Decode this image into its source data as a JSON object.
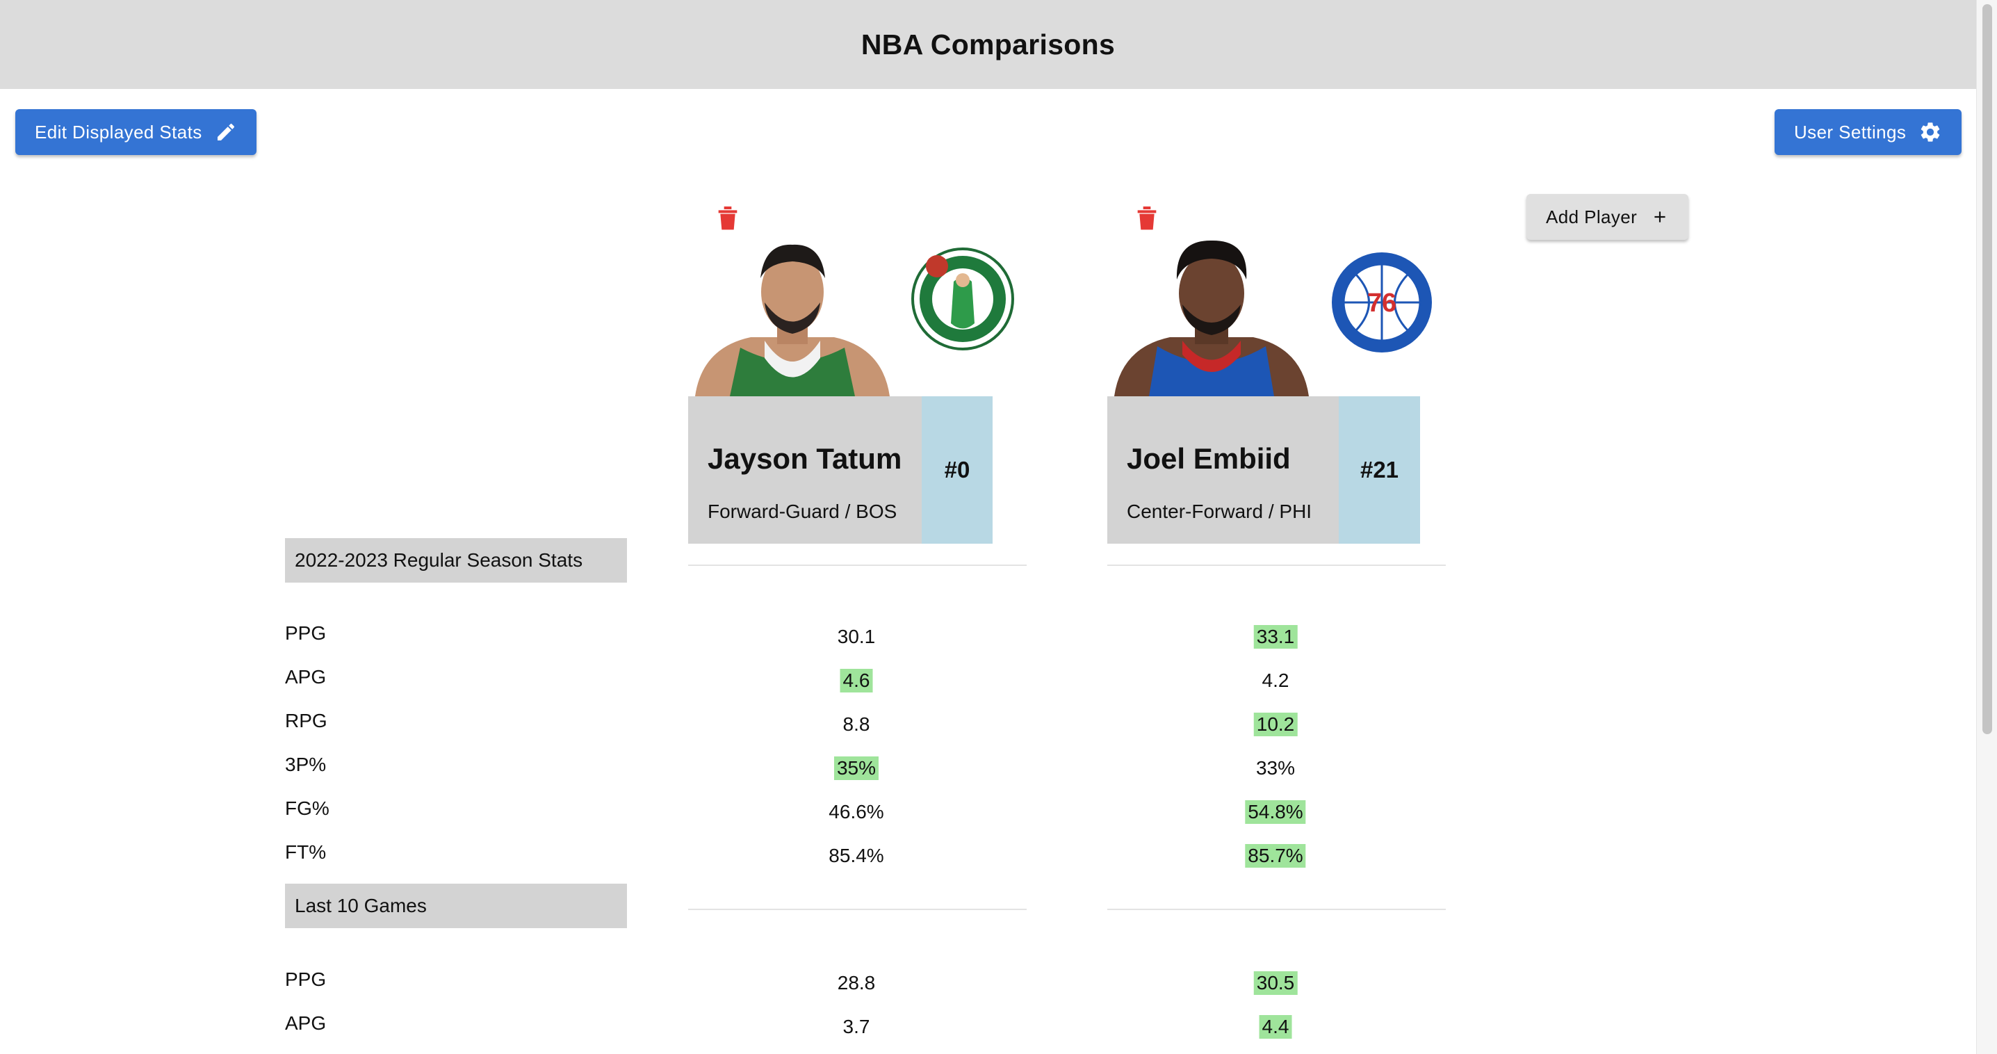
{
  "header": {
    "title": "NBA Comparisons"
  },
  "toolbar": {
    "edit_stats_label": "Edit Displayed Stats",
    "edit_stats_icon": "pencil-icon",
    "user_settings_label": "User Settings",
    "user_settings_icon": "gear-icon",
    "add_player_label": "Add Player",
    "add_player_icon": "plus-icon"
  },
  "players": [
    {
      "name": "Jayson Tatum",
      "position_team": "Forward-Guard / BOS",
      "number": "#0",
      "jersey_color": "#2e7d3c",
      "team_logo": "celtics-logo",
      "season": [
        "30.1",
        "4.6",
        "8.8",
        "35%",
        "46.6%",
        "85.4%"
      ],
      "season_best": [
        false,
        true,
        false,
        true,
        false,
        false
      ],
      "last10": [
        "28.8",
        "3.7"
      ],
      "last10_best": [
        false,
        false
      ]
    },
    {
      "name": "Joel Embiid",
      "position_team": "Center-Forward / PHI",
      "number": "#21",
      "jersey_color": "#1d56b5",
      "team_logo": "76ers-logo",
      "season": [
        "33.1",
        "4.2",
        "10.2",
        "33%",
        "54.8%",
        "85.7%"
      ],
      "season_best": [
        true,
        false,
        true,
        false,
        true,
        true
      ],
      "last10": [
        "30.5",
        "4.4"
      ],
      "last10_best": [
        true,
        true
      ]
    }
  ],
  "sections": {
    "season": {
      "title": "2022-2023 Regular Season Stats",
      "stats": [
        "PPG",
        "APG",
        "RPG",
        "3P%",
        "FG%",
        "FT%"
      ]
    },
    "last10": {
      "title": "Last 10 Games",
      "stats": [
        "PPG",
        "APG"
      ]
    }
  },
  "colors": {
    "header_bg": "#dcdcdc",
    "primary_button": "#3474d4",
    "best_highlight": "#9fe49b",
    "number_box": "#b8d8e4",
    "delete_icon": "#e53935"
  }
}
